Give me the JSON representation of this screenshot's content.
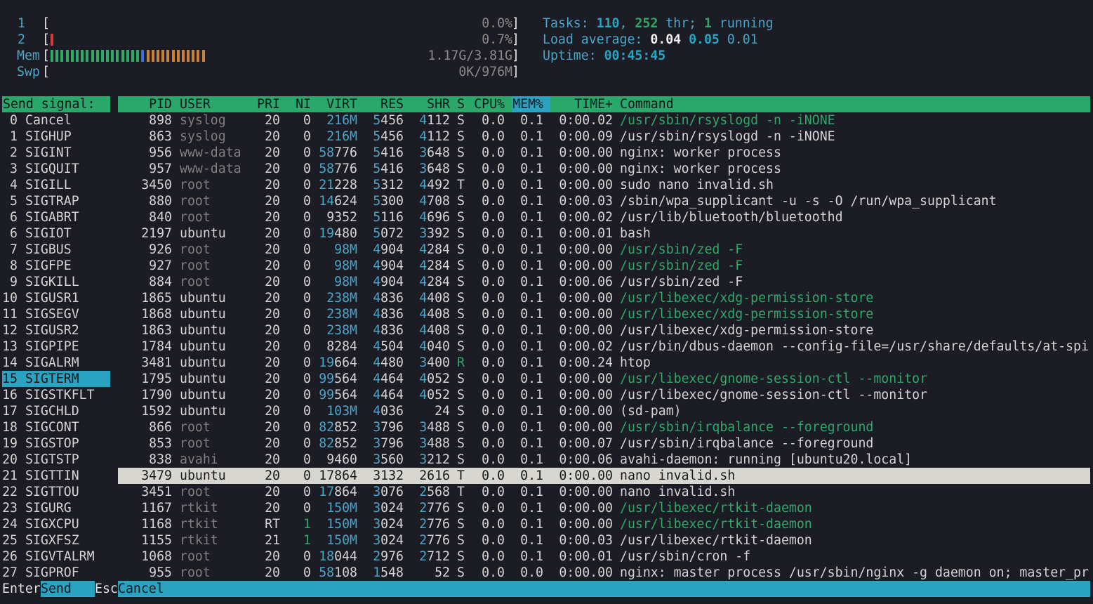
{
  "meters": [
    {
      "label": "1",
      "value": "0.0%",
      "bars": []
    },
    {
      "label": "2",
      "value": "0.7%",
      "bars": [
        {
          "n": 1,
          "color": "#d23a3a"
        }
      ]
    },
    {
      "label": "Mem",
      "value": "1.17G/3.81G",
      "bars": [
        {
          "n": 18,
          "color": "#2fa86a"
        },
        {
          "n": 1,
          "color": "#3a6fd4"
        },
        {
          "n": 12,
          "color": "#c9803a"
        }
      ]
    },
    {
      "label": "Swp",
      "value": "0K/976M",
      "bars": []
    }
  ],
  "info": {
    "tasks_label": "Tasks: ",
    "tasks": "110",
    "thr_sep": ", ",
    "thr": "252",
    "thr_label": " thr; ",
    "running": "1",
    "running_label": " running",
    "load_label": "Load average: ",
    "load1": "0.04",
    "load5": "0.05",
    "load15": "0.01",
    "uptime_label": "Uptime: ",
    "uptime": "00:45:45"
  },
  "colors": {
    "accent_green": "#2aa86a",
    "accent_teal": "#2aa3c0",
    "background": "#1c1c24"
  },
  "header": {
    "send_signal": "Send signal:",
    "pid": "PID",
    "user": "USER",
    "pri": "PRI",
    "ni": "NI",
    "virt": "VIRT",
    "res": "RES",
    "shr": "SHR",
    "s": "S",
    "cpu": "CPU%",
    "mem": "MEM%",
    "time": "TIME+",
    "command": "Command"
  },
  "signals": [
    {
      "num": "0",
      "name": "Cancel"
    },
    {
      "num": "1",
      "name": "SIGHUP"
    },
    {
      "num": "2",
      "name": "SIGINT"
    },
    {
      "num": "3",
      "name": "SIGQUIT"
    },
    {
      "num": "4",
      "name": "SIGILL"
    },
    {
      "num": "5",
      "name": "SIGTRAP"
    },
    {
      "num": "6",
      "name": "SIGABRT"
    },
    {
      "num": "6",
      "name": "SIGIOT"
    },
    {
      "num": "7",
      "name": "SIGBUS"
    },
    {
      "num": "8",
      "name": "SIGFPE"
    },
    {
      "num": "9",
      "name": "SIGKILL"
    },
    {
      "num": "10",
      "name": "SIGUSR1"
    },
    {
      "num": "11",
      "name": "SIGSEGV"
    },
    {
      "num": "12",
      "name": "SIGUSR2"
    },
    {
      "num": "13",
      "name": "SIGPIPE"
    },
    {
      "num": "14",
      "name": "SIGALRM"
    },
    {
      "num": "15",
      "name": "SIGTERM",
      "selected": true
    },
    {
      "num": "16",
      "name": "SIGSTKFLT"
    },
    {
      "num": "17",
      "name": "SIGCHLD"
    },
    {
      "num": "18",
      "name": "SIGCONT"
    },
    {
      "num": "19",
      "name": "SIGSTOP"
    },
    {
      "num": "20",
      "name": "SIGTSTP"
    },
    {
      "num": "21",
      "name": "SIGTTIN"
    },
    {
      "num": "22",
      "name": "SIGTTOU"
    },
    {
      "num": "23",
      "name": "SIGURG"
    },
    {
      "num": "24",
      "name": "SIGXCPU"
    },
    {
      "num": "25",
      "name": "SIGXFSZ"
    },
    {
      "num": "26",
      "name": "SIGVTALRM"
    },
    {
      "num": "27",
      "name": "SIGPROF"
    }
  ],
  "processes": [
    {
      "pid": "898",
      "user": "syslog",
      "pri": "20",
      "ni": "0",
      "virt": "216M",
      "res": "5456",
      "shr": "4112",
      "s": "S",
      "cpu": "0.0",
      "mem": "0.1",
      "time": "0:00.02",
      "cmd": "/usr/sbin/rsyslogd -n -iNONE",
      "dim_user": true,
      "thread": true
    },
    {
      "pid": "863",
      "user": "syslog",
      "pri": "20",
      "ni": "0",
      "virt": "216M",
      "res": "5456",
      "shr": "4112",
      "s": "S",
      "cpu": "0.0",
      "mem": "0.1",
      "time": "0:00.09",
      "cmd": "/usr/sbin/rsyslogd -n -iNONE",
      "dim_user": true
    },
    {
      "pid": "956",
      "user": "www-data",
      "pri": "20",
      "ni": "0",
      "virt": "58776",
      "res": "5416",
      "shr": "3648",
      "s": "S",
      "cpu": "0.0",
      "mem": "0.1",
      "time": "0:00.00",
      "cmd": "nginx: worker process",
      "dim_user": true
    },
    {
      "pid": "957",
      "user": "www-data",
      "pri": "20",
      "ni": "0",
      "virt": "58776",
      "res": "5416",
      "shr": "3648",
      "s": "S",
      "cpu": "0.0",
      "mem": "0.1",
      "time": "0:00.00",
      "cmd": "nginx: worker process",
      "dim_user": true
    },
    {
      "pid": "3450",
      "user": "root",
      "pri": "20",
      "ni": "0",
      "virt": "21228",
      "res": "5312",
      "shr": "4492",
      "s": "T",
      "cpu": "0.0",
      "mem": "0.1",
      "time": "0:00.00",
      "cmd": "sudo nano invalid.sh",
      "dim_user": true
    },
    {
      "pid": "880",
      "user": "root",
      "pri": "20",
      "ni": "0",
      "virt": "14624",
      "res": "5300",
      "shr": "4708",
      "s": "S",
      "cpu": "0.0",
      "mem": "0.1",
      "time": "0:00.03",
      "cmd": "/sbin/wpa_supplicant -u -s -O /run/wpa_supplicant",
      "dim_user": true
    },
    {
      "pid": "840",
      "user": "root",
      "pri": "20",
      "ni": "0",
      "virt": "9352",
      "res": "5116",
      "shr": "4696",
      "s": "S",
      "cpu": "0.0",
      "mem": "0.1",
      "time": "0:00.02",
      "cmd": "/usr/lib/bluetooth/bluetoothd",
      "dim_user": true
    },
    {
      "pid": "2197",
      "user": "ubuntu",
      "pri": "20",
      "ni": "0",
      "virt": "19480",
      "res": "5072",
      "shr": "3392",
      "s": "S",
      "cpu": "0.0",
      "mem": "0.1",
      "time": "0:00.01",
      "cmd": "bash"
    },
    {
      "pid": "926",
      "user": "root",
      "pri": "20",
      "ni": "0",
      "virt": "98M",
      "res": "4904",
      "shr": "4284",
      "s": "S",
      "cpu": "0.0",
      "mem": "0.1",
      "time": "0:00.00",
      "cmd": "/usr/sbin/zed -F",
      "dim_user": true,
      "thread": true
    },
    {
      "pid": "927",
      "user": "root",
      "pri": "20",
      "ni": "0",
      "virt": "98M",
      "res": "4904",
      "shr": "4284",
      "s": "S",
      "cpu": "0.0",
      "mem": "0.1",
      "time": "0:00.00",
      "cmd": "/usr/sbin/zed -F",
      "dim_user": true,
      "thread": true
    },
    {
      "pid": "884",
      "user": "root",
      "pri": "20",
      "ni": "0",
      "virt": "98M",
      "res": "4904",
      "shr": "4284",
      "s": "S",
      "cpu": "0.0",
      "mem": "0.1",
      "time": "0:00.06",
      "cmd": "/usr/sbin/zed -F",
      "dim_user": true
    },
    {
      "pid": "1865",
      "user": "ubuntu",
      "pri": "20",
      "ni": "0",
      "virt": "238M",
      "res": "4836",
      "shr": "4408",
      "s": "S",
      "cpu": "0.0",
      "mem": "0.1",
      "time": "0:00.00",
      "cmd": "/usr/libexec/xdg-permission-store",
      "thread": true
    },
    {
      "pid": "1868",
      "user": "ubuntu",
      "pri": "20",
      "ni": "0",
      "virt": "238M",
      "res": "4836",
      "shr": "4408",
      "s": "S",
      "cpu": "0.0",
      "mem": "0.1",
      "time": "0:00.00",
      "cmd": "/usr/libexec/xdg-permission-store",
      "thread": true
    },
    {
      "pid": "1863",
      "user": "ubuntu",
      "pri": "20",
      "ni": "0",
      "virt": "238M",
      "res": "4836",
      "shr": "4408",
      "s": "S",
      "cpu": "0.0",
      "mem": "0.1",
      "time": "0:00.00",
      "cmd": "/usr/libexec/xdg-permission-store"
    },
    {
      "pid": "1784",
      "user": "ubuntu",
      "pri": "20",
      "ni": "0",
      "virt": "8284",
      "res": "4504",
      "shr": "4040",
      "s": "S",
      "cpu": "0.0",
      "mem": "0.1",
      "time": "0:00.02",
      "cmd": "/usr/bin/dbus-daemon --config-file=/usr/share/defaults/at-spi"
    },
    {
      "pid": "3481",
      "user": "ubuntu",
      "pri": "20",
      "ni": "0",
      "virt": "19664",
      "res": "4480",
      "shr": "3400",
      "s": "R",
      "cpu": "0.0",
      "mem": "0.1",
      "time": "0:00.24",
      "cmd": "htop",
      "run": true
    },
    {
      "pid": "1795",
      "user": "ubuntu",
      "pri": "20",
      "ni": "0",
      "virt": "99564",
      "res": "4464",
      "shr": "4052",
      "s": "S",
      "cpu": "0.0",
      "mem": "0.1",
      "time": "0:00.00",
      "cmd": "/usr/libexec/gnome-session-ctl --monitor",
      "thread": true
    },
    {
      "pid": "1790",
      "user": "ubuntu",
      "pri": "20",
      "ni": "0",
      "virt": "99564",
      "res": "4464",
      "shr": "4052",
      "s": "S",
      "cpu": "0.0",
      "mem": "0.1",
      "time": "0:00.00",
      "cmd": "/usr/libexec/gnome-session-ctl --monitor"
    },
    {
      "pid": "1592",
      "user": "ubuntu",
      "pri": "20",
      "ni": "0",
      "virt": "103M",
      "res": "4036",
      "shr": "24",
      "s": "S",
      "cpu": "0.0",
      "mem": "0.1",
      "time": "0:00.00",
      "cmd": "(sd-pam)"
    },
    {
      "pid": "866",
      "user": "root",
      "pri": "20",
      "ni": "0",
      "virt": "82852",
      "res": "3796",
      "shr": "3488",
      "s": "S",
      "cpu": "0.0",
      "mem": "0.1",
      "time": "0:00.00",
      "cmd": "/usr/sbin/irqbalance --foreground",
      "dim_user": true,
      "thread": true
    },
    {
      "pid": "853",
      "user": "root",
      "pri": "20",
      "ni": "0",
      "virt": "82852",
      "res": "3796",
      "shr": "3488",
      "s": "S",
      "cpu": "0.0",
      "mem": "0.1",
      "time": "0:00.07",
      "cmd": "/usr/sbin/irqbalance --foreground",
      "dim_user": true
    },
    {
      "pid": "838",
      "user": "avahi",
      "pri": "20",
      "ni": "0",
      "virt": "9460",
      "res": "3560",
      "shr": "3212",
      "s": "S",
      "cpu": "0.0",
      "mem": "0.1",
      "time": "0:00.06",
      "cmd": "avahi-daemon: running [ubuntu20.local]",
      "dim_user": true
    },
    {
      "pid": "3479",
      "user": "ubuntu",
      "pri": "20",
      "ni": "0",
      "virt": "17864",
      "res": "3132",
      "shr": "2616",
      "s": "T",
      "cpu": "0.0",
      "mem": "0.1",
      "time": "0:00.00",
      "cmd": "nano invalid.sh",
      "selected": true
    },
    {
      "pid": "3451",
      "user": "root",
      "pri": "20",
      "ni": "0",
      "virt": "17864",
      "res": "3076",
      "shr": "2568",
      "s": "T",
      "cpu": "0.0",
      "mem": "0.1",
      "time": "0:00.00",
      "cmd": "nano invalid.sh",
      "dim_user": true
    },
    {
      "pid": "1167",
      "user": "rtkit",
      "pri": "20",
      "ni": "0",
      "virt": "150M",
      "res": "3024",
      "shr": "2776",
      "s": "S",
      "cpu": "0.0",
      "mem": "0.1",
      "time": "0:00.00",
      "cmd": "/usr/libexec/rtkit-daemon",
      "dim_user": true,
      "thread": true
    },
    {
      "pid": "1168",
      "user": "rtkit",
      "pri": "RT",
      "ni": "1",
      "virt": "150M",
      "res": "3024",
      "shr": "2776",
      "s": "S",
      "cpu": "0.0",
      "mem": "0.1",
      "time": "0:00.00",
      "cmd": "/usr/libexec/rtkit-daemon",
      "dim_user": true,
      "thread": true,
      "ni_green": true
    },
    {
      "pid": "1155",
      "user": "rtkit",
      "pri": "21",
      "ni": "1",
      "virt": "150M",
      "res": "3024",
      "shr": "2776",
      "s": "S",
      "cpu": "0.0",
      "mem": "0.1",
      "time": "0:00.03",
      "cmd": "/usr/libexec/rtkit-daemon",
      "dim_user": true,
      "ni_green": true
    },
    {
      "pid": "1068",
      "user": "root",
      "pri": "20",
      "ni": "0",
      "virt": "18044",
      "res": "2976",
      "shr": "2712",
      "s": "S",
      "cpu": "0.0",
      "mem": "0.1",
      "time": "0:00.01",
      "cmd": "/usr/sbin/cron -f",
      "dim_user": true
    },
    {
      "pid": "955",
      "user": "root",
      "pri": "20",
      "ni": "0",
      "virt": "58108",
      "res": "1548",
      "shr": "52",
      "s": "S",
      "cpu": "0.0",
      "mem": "0.0",
      "time": "0:00.00",
      "cmd": "nginx: master process /usr/sbin/nginx -g daemon on; master_pr",
      "dim_user": true
    }
  ],
  "footer": {
    "enter_key": "Enter",
    "enter_label": "Send",
    "esc_key": "Esc",
    "esc_label": "Cancel"
  }
}
